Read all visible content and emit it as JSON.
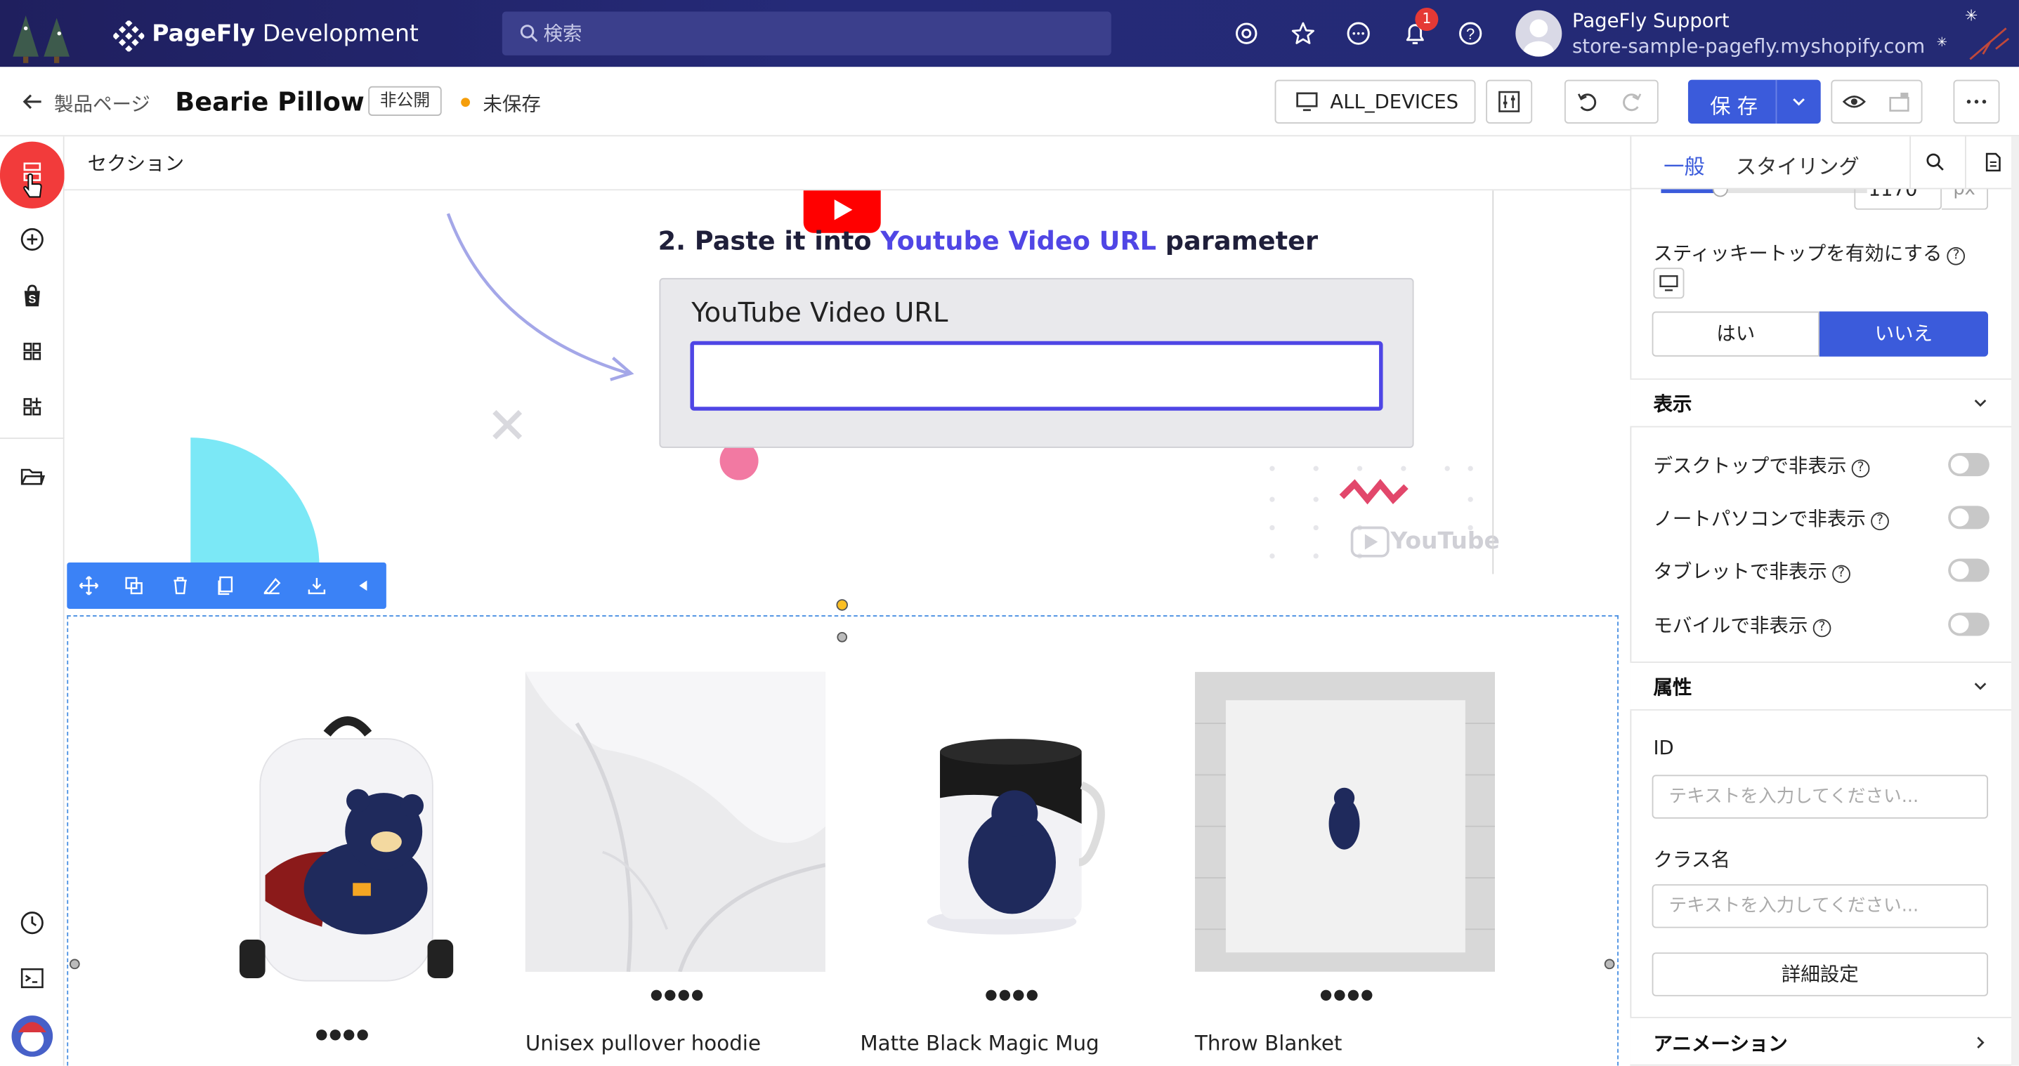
{
  "topbar": {
    "app_name_bold": "PageFly",
    "app_name_rest": " Development",
    "search_placeholder": "検索",
    "notification_count": "1",
    "user_name": "PageFly Support",
    "user_store": "store-sample-pagefly.myshopify.com"
  },
  "subbar": {
    "back_label": "製品ページ",
    "page_name": "Bearie Pillow",
    "status": "非公開",
    "unsaved": "未保存",
    "devices": "ALL_DEVICES",
    "save_label": "保 存"
  },
  "canvas": {
    "section_label": "セクション",
    "yt_title_prefix": "2. Paste it into ",
    "yt_title_highlight": "Youtube Video URL",
    "yt_title_suffix": " parameter",
    "yt_field_label": "YouTube Video URL",
    "yt_wordmark": "YouTube",
    "products": [
      {
        "name": "",
        "image": "backpack"
      },
      {
        "name": "Unisex pullover hoodie",
        "image": "hoodie"
      },
      {
        "name": "Matte Black Magic Mug",
        "image": "mug"
      },
      {
        "name": "Throw Blanket",
        "image": "blanket"
      }
    ]
  },
  "right_panel": {
    "tab_general": "一般",
    "tab_styling": "スタイリング",
    "width_value": "1170",
    "width_unit": "px",
    "sticky_label": "スティッキートップを有効にする",
    "yes": "はい",
    "no": "いいえ",
    "display_section": "表示",
    "toggles": [
      {
        "label": "デスクトップで非表示",
        "on": false
      },
      {
        "label": "ノートパソコンで非表示",
        "on": false
      },
      {
        "label": "タブレットで非表示",
        "on": false
      },
      {
        "label": "モバイルで非表示",
        "on": false
      }
    ],
    "attributes_section": "属性",
    "id_label": "ID",
    "id_placeholder": "テキストを入力してください...",
    "class_label": "クラス名",
    "class_placeholder": "テキストを入力してください...",
    "advanced_button": "詳細設定",
    "animation_section": "アニメーション"
  },
  "colors": {
    "topbar": "#23236a",
    "accent": "#3b5bdb",
    "selection": "#3b82f6",
    "active_rail": "#f23b3b"
  }
}
